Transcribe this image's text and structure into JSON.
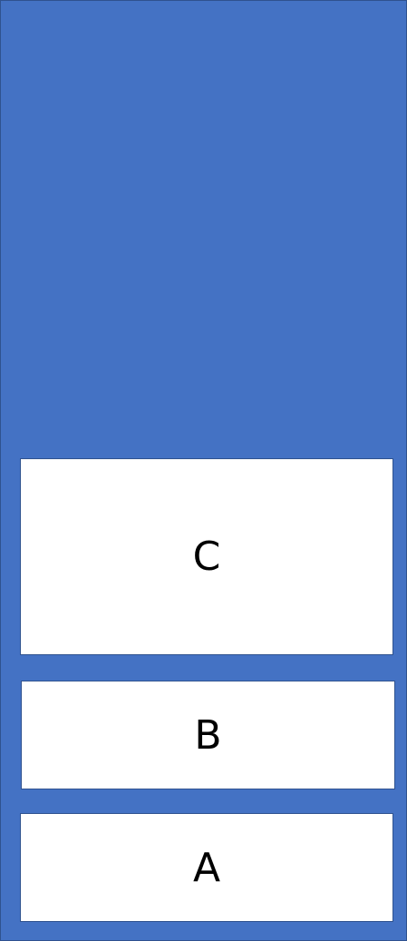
{
  "diagram": {
    "colors": {
      "container_fill": "#4472c4",
      "container_border": "#2f528f",
      "box_fill": "#ffffff",
      "box_border": "#2f528f",
      "text": "#000000"
    },
    "boxes": [
      {
        "label": "C"
      },
      {
        "label": "B"
      },
      {
        "label": "A"
      }
    ]
  }
}
